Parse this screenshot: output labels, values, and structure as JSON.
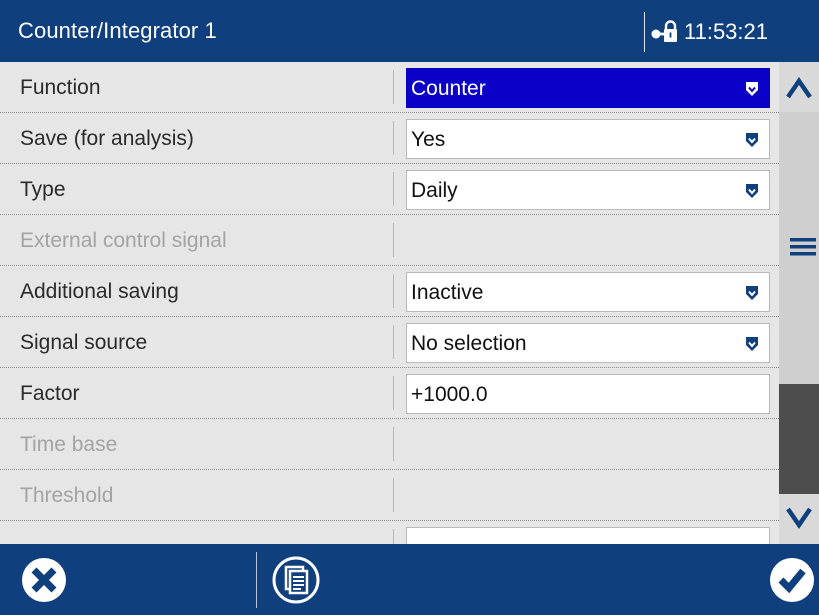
{
  "header": {
    "title": "Counter/Integrator 1",
    "clock": "11:53:21",
    "lock_icon": "key-lock-icon"
  },
  "rows": [
    {
      "label": "Function",
      "value": "Counter",
      "type": "dropdown",
      "selected": true,
      "disabled": false
    },
    {
      "label": "Save (for analysis)",
      "value": "Yes",
      "type": "dropdown",
      "selected": false,
      "disabled": false
    },
    {
      "label": "Type",
      "value": "Daily",
      "type": "dropdown",
      "selected": false,
      "disabled": false
    },
    {
      "label": "External control signal",
      "value": "",
      "type": "none",
      "selected": false,
      "disabled": true
    },
    {
      "label": "Additional saving",
      "value": "Inactive",
      "type": "dropdown",
      "selected": false,
      "disabled": false
    },
    {
      "label": "Signal source",
      "value": "No selection",
      "type": "dropdown",
      "selected": false,
      "disabled": false
    },
    {
      "label": "Factor",
      "value": "+1000.0",
      "type": "input",
      "selected": false,
      "disabled": false
    },
    {
      "label": "Time base",
      "value": "",
      "type": "none",
      "selected": false,
      "disabled": true
    },
    {
      "label": "Threshold",
      "value": "",
      "type": "none",
      "selected": false,
      "disabled": true
    }
  ],
  "scrollbar": {
    "up_icon": "chevron-up-icon",
    "down_icon": "chevron-down-icon",
    "menu_icon": "menu-icon"
  },
  "footer": {
    "cancel_icon": "cancel-icon",
    "document_icon": "document-icon",
    "confirm_icon": "confirm-icon"
  },
  "colors": {
    "header_bg": "#0f3f7d",
    "selected_bg": "#0a00c8",
    "dropdown_icon": "#0f3f7d",
    "scroll_thumb": "#4d4d4d"
  }
}
